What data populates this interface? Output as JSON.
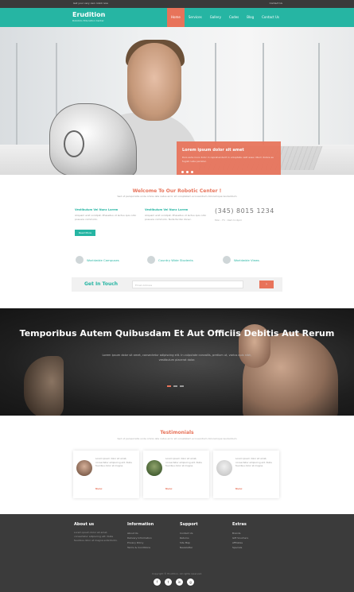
{
  "topbar": {
    "left_text": "Get your very own robot now",
    "right_text": "Contact Us"
  },
  "header": {
    "logo": "Erudition",
    "logo_sub": "Robotics Education Center"
  },
  "nav": {
    "items": [
      {
        "label": "Home",
        "active": true
      },
      {
        "label": "Services",
        "active": false
      },
      {
        "label": "Gallery",
        "active": false
      },
      {
        "label": "Codes",
        "active": false
      },
      {
        "label": "Blog",
        "active": false
      },
      {
        "label": "Contact Us",
        "active": false
      }
    ]
  },
  "hero": {
    "slide_title": "Lorem ipsum dolor sit amet",
    "slide_text": "Duis aute irure dolor in reprehenderit in voluptate velit esse cillum dolore eu fugiat nulla pariatur."
  },
  "welcome": {
    "title": "Welcome To Our Robotic Center !",
    "subtitle": "Sed ut perspiciatis unde omnis iste natus error sit voluptatem accusantium doloremque laudantium",
    "col1_head": "Vestibulum Vel Nunc Lorem",
    "col1_text": "Aliquam erat volutpat. Phasellus ut lectus quis odio posuere commodo.",
    "col2_head": "Vestibulum Vel Nunc Lorem",
    "col2_text": "Aliquam erat volutpat. Phasellus ut lectus quis odio posuere commodo. Nulla facilisi donec.",
    "read_more": "Read More",
    "phone": "(345) 8015 1234",
    "phone_lines": "Mon - Fri : 9am to 6pm"
  },
  "features": [
    {
      "label": "Worldwide Campuses"
    },
    {
      "label": "Country Wide Students"
    },
    {
      "label": "Worldwide Views"
    }
  ],
  "get_in_touch": {
    "label": "Get In Touch",
    "placeholder": "Email Address",
    "button": "›"
  },
  "band": {
    "headline": "Temporibus Autem Quibusdam Et Aut Officiis Debitis Aut Rerum",
    "subtext": "Lorem ipsum dolor sit amet, consectetur adipiscing elit. In vulputate convallis, pretium ut, varius quis nibh, vestibulum placerat dolor."
  },
  "testimonials": {
    "title": "Testimonials",
    "subtitle": "Sed ut perspiciatis unde omnis iste natus error sit voluptatem accusantium doloremque laudantium",
    "cards": [
      {
        "text": "Lorem ipsum dolor sit amet, consectetur adipiscing elit. Nulla faucibus dolor et magna.",
        "name": "Nunc"
      },
      {
        "text": "Lorem ipsum dolor sit amet, consectetur adipiscing elit. Nulla faucibus dolor et magna.",
        "name": "Nunc"
      },
      {
        "text": "Lorem ipsum dolor sit amet, consectetur adipiscing elit. Nulla faucibus dolor et magna.",
        "name": "Nunc"
      }
    ]
  },
  "footer": {
    "about_head": "About us",
    "about_text": "Lorem ipsum dolor sit amet, consectetur adipiscing elit. Nulla faucibus dolor et magna sollicitudin.",
    "info_head": "Information",
    "info_items": [
      "About Us",
      "Delivery Information",
      "Privacy Policy",
      "Terms & Conditions"
    ],
    "support_head": "Support",
    "support_items": [
      "Contact Us",
      "Returns",
      "Site Map",
      "Newsletter"
    ],
    "extras_head": "Extras",
    "extras_items": [
      "Brands",
      "Gift Vouchers",
      "Affiliates",
      "Specials"
    ],
    "copyright": "Copyright © Erudition. All rights reserved.",
    "socials": [
      "f",
      "t",
      "in",
      "g"
    ]
  },
  "colors": {
    "teal": "#26b5a3",
    "coral": "#e8735a",
    "dark": "#3b3b3b"
  }
}
